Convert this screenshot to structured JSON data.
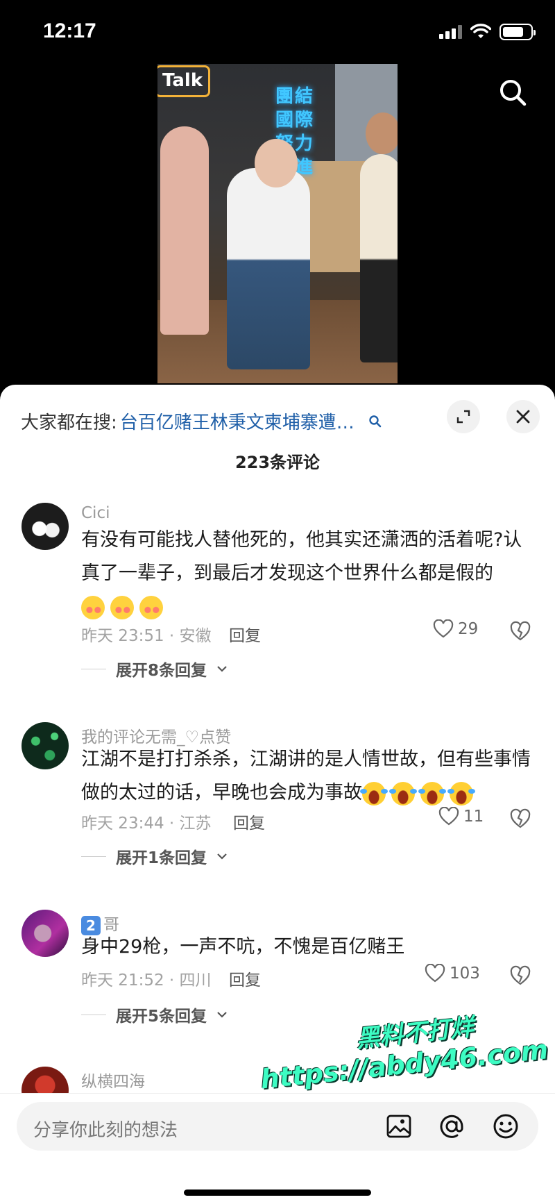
{
  "status_bar": {
    "time": "12:17",
    "battery_level": 0.75
  },
  "video": {
    "sign_text": "Talk",
    "neon_text": "團結 國際 努力 精進"
  },
  "sheet": {
    "hot_search_label": "大家都在搜:",
    "hot_search_query": "台百亿赌王林秉文柬埔寨遭…",
    "comment_count": "223条评论"
  },
  "comments": [
    {
      "username": "Cici",
      "text": "有没有可能找人替他死的，他其实还潇洒的活着呢?认真了一辈子，到最后才发现这个世界什么都是假的",
      "meta": "昨天 23:51 · 安徽",
      "reply": "回复",
      "likes": "29",
      "expand": "展开8条回复"
    },
    {
      "username": "我的评论无需_♡点赞",
      "text": "江湖不是打打杀杀，江湖讲的是人情世故，但有些事情做的太过的话，早晚也会成为事故",
      "meta": "昨天 23:44 · 江苏",
      "reply": "回复",
      "likes": "11",
      "expand": "展开1条回复"
    },
    {
      "username": "哥",
      "badge": "2",
      "text": "身中29枪，一声不吭，不愧是百亿赌王",
      "meta": "昨天 21:52 · 四川",
      "reply": "回复",
      "likes": "103",
      "expand": "展开5条回复"
    },
    {
      "username": "纵横四海"
    }
  ],
  "watermark": {
    "line1": "黑料不打烊",
    "line2": "https://abdy46.com"
  },
  "input": {
    "placeholder": "分享你此刻的想法"
  },
  "icons": [
    "search-icon",
    "expand-icon",
    "close-icon",
    "heart-icon",
    "dislike-icon",
    "chevron-down-icon",
    "image-icon",
    "at-icon",
    "emoji-icon"
  ]
}
